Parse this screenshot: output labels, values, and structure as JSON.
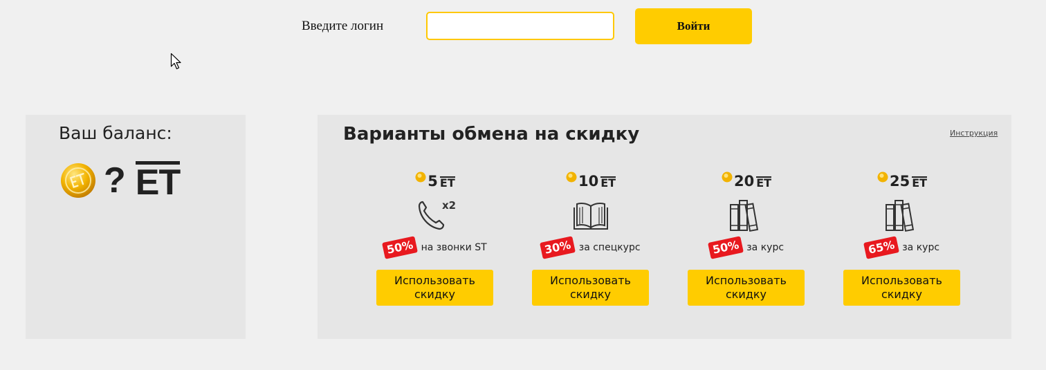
{
  "login": {
    "label": "Введите логин",
    "input_value": "",
    "placeholder": "",
    "button_label": "Войти"
  },
  "balance": {
    "title": "Ваш баланс:",
    "value": "?",
    "unit": "ET"
  },
  "exchange": {
    "title": "Варианты обмена на скидку",
    "instructions_link": "Инструкция",
    "offers": [
      {
        "amount": "5",
        "unit": "ET",
        "icon": "phone-x2-icon",
        "icon_label": "x2",
        "discount": "50%",
        "description": "на звонки ST",
        "button_label": "Использовать скидку"
      },
      {
        "amount": "10",
        "unit": "ET",
        "icon": "open-book-icon",
        "discount": "30%",
        "description": "за спецкурс",
        "button_label": "Использовать скидку"
      },
      {
        "amount": "20",
        "unit": "ET",
        "icon": "books-icon",
        "discount": "50%",
        "description": "за курс",
        "button_label": "Использовать скидку"
      },
      {
        "amount": "25",
        "unit": "ET",
        "icon": "books-icon",
        "discount": "65%",
        "description": "за курс",
        "button_label": "Использовать скидку"
      }
    ]
  },
  "colors": {
    "accent_yellow": "#ffcc00",
    "badge_red": "#e8191f",
    "panel_bg": "#e6e6e6",
    "page_bg": "#f0f0f0"
  }
}
